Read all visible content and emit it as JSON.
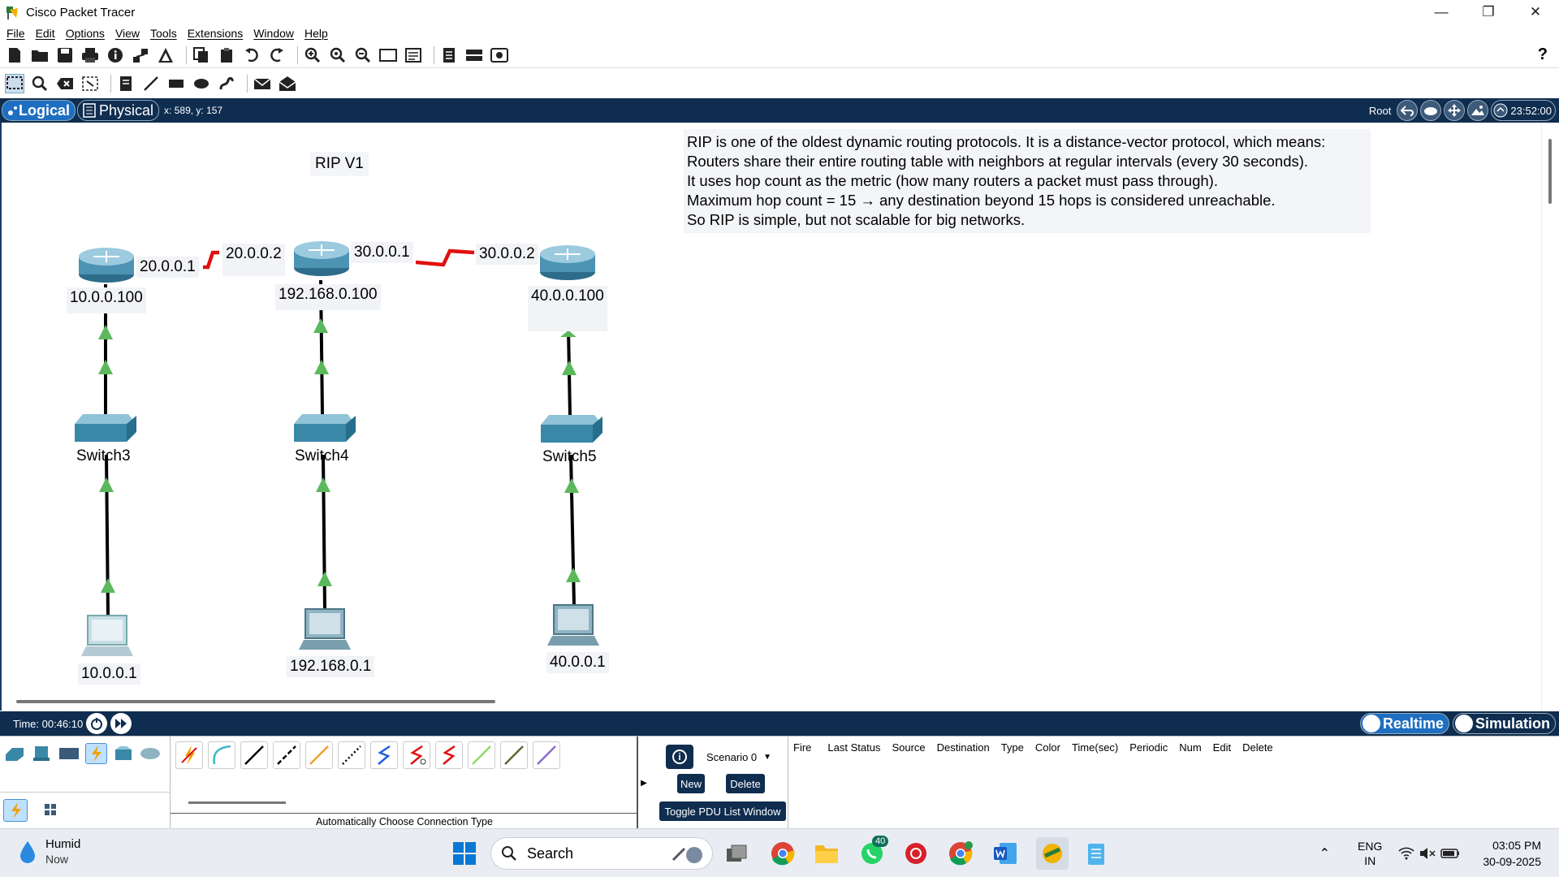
{
  "window": {
    "title": "Cisco Packet Tracer"
  },
  "menu": [
    "File",
    "Edit",
    "Options",
    "View",
    "Tools",
    "Extensions",
    "Window",
    "Help"
  ],
  "workspace": {
    "tab_logical": "Logical",
    "tab_physical": "Physical",
    "coords": "x: 589, y: 157",
    "root_label": "Root",
    "clock": "23:52:00"
  },
  "canvas": {
    "title_note": "RIP V1",
    "description_lines": [
      "RIP is one of the oldest dynamic routing protocols. It is a distance-vector protocol, which means:",
      "Routers share their entire routing table with neighbors at regular intervals (every 30 seconds).",
      "It uses hop count as the metric (how many routers a packet must pass through).",
      "Maximum hop count = 15 → any destination beyond 15 hops is considered unreachable.",
      "So RIP is simple, but not scalable for big networks."
    ],
    "ip_labels": {
      "r1_serial": "20.0.0.1",
      "r2_serial_left": "20.0.0.2",
      "r2_serial_right": "30.0.0.1",
      "r3_serial": "30.0.0.2",
      "r1_lan": "10.0.0.100",
      "r2_lan": "192.168.0.100",
      "r3_lan": "40.0.0.100",
      "pc1": "10.0.0.1",
      "pc2": "192.168.0.1",
      "pc3": "40.0.0.1"
    },
    "switches": [
      "Switch3",
      "Switch4",
      "Switch5"
    ],
    "serial_link_color": "#e01010",
    "link_up_color": "#5cb85c"
  },
  "status": {
    "time": "Time: 00:46:10",
    "realtime": "Realtime",
    "simulation": "Simulation"
  },
  "bottom": {
    "connection_caption": "Automatically Choose Connection Type",
    "scenario": "Scenario 0",
    "new_btn": "New",
    "delete_btn": "Delete",
    "toggle_btn": "Toggle PDU List Window",
    "pdu_columns": [
      "Fire",
      "Last Status",
      "Source",
      "Destination",
      "Type",
      "Color",
      "Time(sec)",
      "Periodic",
      "Num",
      "Edit",
      "Delete"
    ]
  },
  "taskbar": {
    "weather_title": "Humid",
    "weather_sub": "Now",
    "search": "Search",
    "whatsapp_badge": "40",
    "lang1": "ENG",
    "lang2": "IN",
    "time": "03:05 PM",
    "date": "30-09-2025"
  }
}
